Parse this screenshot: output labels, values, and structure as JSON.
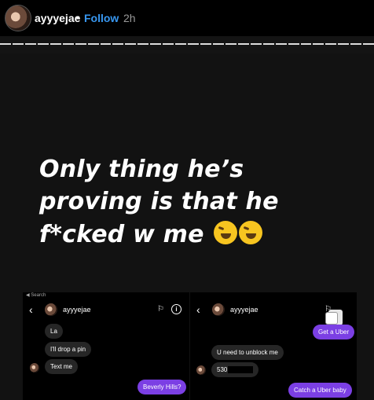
{
  "header": {
    "username": "ayyyejae",
    "separator": "•",
    "follow_label": "Follow",
    "time": "2h"
  },
  "story": {
    "caption": "Only thing he’s proving is that he f*cked w me"
  },
  "left_panel": {
    "status": "◀ Search",
    "back": "‹",
    "name": "ayyyejae",
    "flag": "⚐",
    "info": "i",
    "messages": [
      "La",
      "I'll drop a pin",
      "Text me",
      "Beverly Hills?"
    ]
  },
  "right_panel": {
    "back": "‹",
    "name": "ayyyejae",
    "flag": "⚐",
    "messages": [
      "Get a Uber",
      "U need to unblock me",
      "530",
      "Catch a Uber baby"
    ]
  }
}
